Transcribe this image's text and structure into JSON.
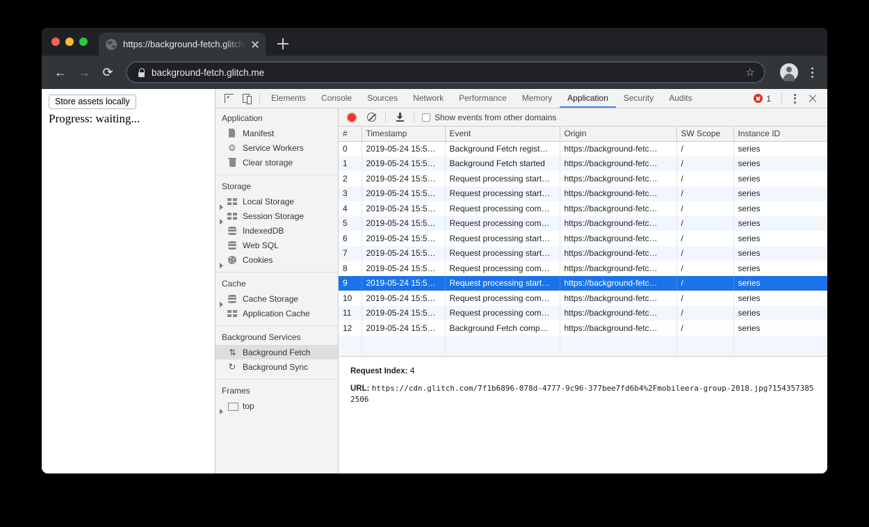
{
  "browser": {
    "tab": {
      "title": "https://background-fetch.glitch.me",
      "favicon_name": "globe-icon",
      "close_name": "tab-close-icon"
    },
    "new_tab_label": "+",
    "nav": {
      "back": "←",
      "forward": "→",
      "reload": "⟳"
    },
    "omnibox": {
      "url": "background-fetch.glitch.me",
      "lock_icon": "lock-icon",
      "star_icon": "star-outline-icon"
    },
    "profile_icon": "avatar-icon",
    "menu_icon": "three-dot-menu-icon"
  },
  "page": {
    "store_assets_button": "Store assets locally",
    "progress_text": "Progress: waiting..."
  },
  "devtools": {
    "tools": {
      "inspect_icon": "inspect-element-icon",
      "device_icon": "device-toolbar-icon"
    },
    "tabs": [
      {
        "label": "Elements",
        "active": false
      },
      {
        "label": "Console",
        "active": false
      },
      {
        "label": "Sources",
        "active": false
      },
      {
        "label": "Network",
        "active": false
      },
      {
        "label": "Performance",
        "active": false
      },
      {
        "label": "Memory",
        "active": false
      },
      {
        "label": "Application",
        "active": true
      },
      {
        "label": "Security",
        "active": false
      },
      {
        "label": "Audits",
        "active": false
      }
    ],
    "error_count": "1",
    "sidebar": [
      {
        "header": "Application",
        "items": [
          {
            "label": "Manifest",
            "icon": "manifest-icon",
            "arrow": "none",
            "selected": false
          },
          {
            "label": "Service Workers",
            "icon": "gear-icon",
            "arrow": "none",
            "selected": false
          },
          {
            "label": "Clear storage",
            "icon": "trash-icon",
            "arrow": "none",
            "selected": false
          }
        ]
      },
      {
        "header": "Storage",
        "items": [
          {
            "label": "Local Storage",
            "icon": "grid-icon",
            "arrow": "closed",
            "selected": false
          },
          {
            "label": "Session Storage",
            "icon": "grid-icon",
            "arrow": "closed",
            "selected": false
          },
          {
            "label": "IndexedDB",
            "icon": "database-icon",
            "arrow": "none",
            "selected": false
          },
          {
            "label": "Web SQL",
            "icon": "database-icon",
            "arrow": "none",
            "selected": false
          },
          {
            "label": "Cookies",
            "icon": "cookie-icon",
            "arrow": "closed",
            "selected": false
          }
        ]
      },
      {
        "header": "Cache",
        "items": [
          {
            "label": "Cache Storage",
            "icon": "database-icon",
            "arrow": "closed",
            "selected": false
          },
          {
            "label": "Application Cache",
            "icon": "grid-icon",
            "arrow": "none",
            "selected": false
          }
        ]
      },
      {
        "header": "Background Services",
        "items": [
          {
            "label": "Background Fetch",
            "icon": "background-fetch-icon",
            "arrow": "none",
            "selected": true
          },
          {
            "label": "Background Sync",
            "icon": "background-sync-icon",
            "arrow": "none",
            "selected": false
          }
        ]
      },
      {
        "header": "Frames",
        "items": [
          {
            "label": "top",
            "icon": "frame-icon",
            "arrow": "closed",
            "selected": false
          }
        ]
      }
    ],
    "panel_toolbar": {
      "record_icon": "record-button-icon",
      "clear_icon": "clear-icon",
      "download_icon": "download-icon",
      "show_events_label": "Show events from other domains",
      "show_events_checked": false
    },
    "events_table": {
      "columns": [
        "#",
        "Timestamp",
        "Event",
        "Origin",
        "SW Scope",
        "Instance ID"
      ],
      "rows": [
        {
          "num": "0",
          "timestamp": "2019-05-24 15:5…",
          "event": "Background Fetch regist…",
          "origin": "https://background-fetc…",
          "scope": "/",
          "instance": "series",
          "selected": false
        },
        {
          "num": "1",
          "timestamp": "2019-05-24 15:5…",
          "event": "Background Fetch started",
          "origin": "https://background-fetc…",
          "scope": "/",
          "instance": "series",
          "selected": false
        },
        {
          "num": "2",
          "timestamp": "2019-05-24 15:5…",
          "event": "Request processing start…",
          "origin": "https://background-fetc…",
          "scope": "/",
          "instance": "series",
          "selected": false
        },
        {
          "num": "3",
          "timestamp": "2019-05-24 15:5…",
          "event": "Request processing start…",
          "origin": "https://background-fetc…",
          "scope": "/",
          "instance": "series",
          "selected": false
        },
        {
          "num": "4",
          "timestamp": "2019-05-24 15:5…",
          "event": "Request processing com…",
          "origin": "https://background-fetc…",
          "scope": "/",
          "instance": "series",
          "selected": false
        },
        {
          "num": "5",
          "timestamp": "2019-05-24 15:5…",
          "event": "Request processing com…",
          "origin": "https://background-fetc…",
          "scope": "/",
          "instance": "series",
          "selected": false
        },
        {
          "num": "6",
          "timestamp": "2019-05-24 15:5…",
          "event": "Request processing start…",
          "origin": "https://background-fetc…",
          "scope": "/",
          "instance": "series",
          "selected": false
        },
        {
          "num": "7",
          "timestamp": "2019-05-24 15:5…",
          "event": "Request processing start…",
          "origin": "https://background-fetc…",
          "scope": "/",
          "instance": "series",
          "selected": false
        },
        {
          "num": "8",
          "timestamp": "2019-05-24 15:5…",
          "event": "Request processing com…",
          "origin": "https://background-fetc…",
          "scope": "/",
          "instance": "series",
          "selected": false
        },
        {
          "num": "9",
          "timestamp": "2019-05-24 15:5…",
          "event": "Request processing start…",
          "origin": "https://background-fetc…",
          "scope": "/",
          "instance": "series",
          "selected": true
        },
        {
          "num": "10",
          "timestamp": "2019-05-24 15:5…",
          "event": "Request processing com…",
          "origin": "https://background-fetc…",
          "scope": "/",
          "instance": "series",
          "selected": false
        },
        {
          "num": "11",
          "timestamp": "2019-05-24 15:5…",
          "event": "Request processing com…",
          "origin": "https://background-fetc…",
          "scope": "/",
          "instance": "series",
          "selected": false
        },
        {
          "num": "12",
          "timestamp": "2019-05-24 15:5…",
          "event": "Background Fetch comp…",
          "origin": "https://background-fetc…",
          "scope": "/",
          "instance": "series",
          "selected": false
        }
      ]
    },
    "detail": {
      "request_index_key": "Request Index:",
      "request_index_value": "4",
      "url_key": "URL:",
      "url_value": "https://cdn.glitch.com/7f1b6896-078d-4777-9c96-377bee7fd6b4%2Fmobileera-group-2018.jpg?1543573852506"
    }
  },
  "colors": {
    "accent": "#1a73e8",
    "record_red": "#e8362a",
    "error_red": "#d93025",
    "chrome_dark": "#323639",
    "tabstrip_dark": "#202124"
  }
}
